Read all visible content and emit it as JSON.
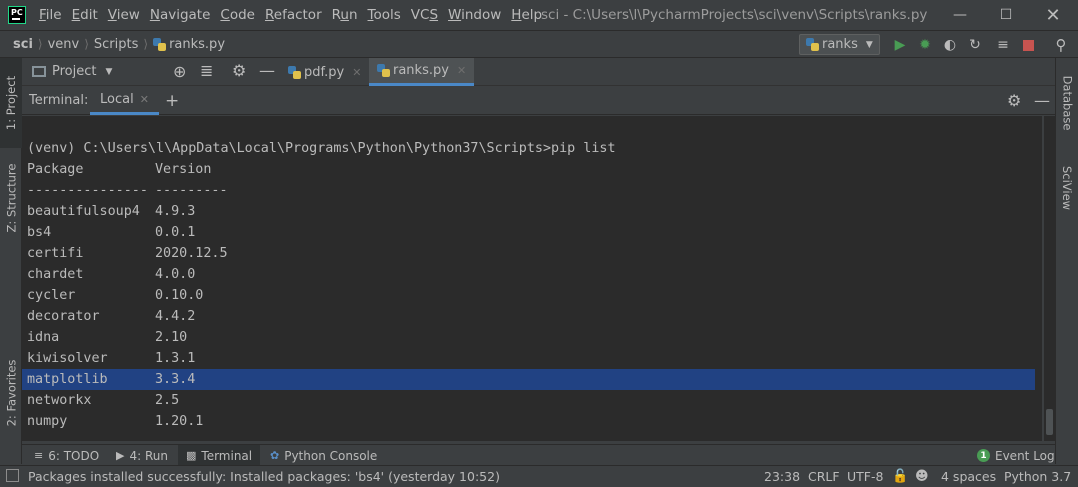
{
  "titlebar": {
    "logo_text": "PC",
    "menu": [
      {
        "pre": "",
        "u": "F",
        "post": "ile"
      },
      {
        "pre": "",
        "u": "E",
        "post": "dit"
      },
      {
        "pre": "",
        "u": "V",
        "post": "iew"
      },
      {
        "pre": "",
        "u": "N",
        "post": "avigate"
      },
      {
        "pre": "",
        "u": "C",
        "post": "ode"
      },
      {
        "pre": "",
        "u": "R",
        "post": "efactor"
      },
      {
        "pre": "R",
        "u": "u",
        "post": "n"
      },
      {
        "pre": "",
        "u": "T",
        "post": "ools"
      },
      {
        "pre": "VC",
        "u": "S",
        "post": ""
      },
      {
        "pre": "",
        "u": "W",
        "post": "indow"
      },
      {
        "pre": "",
        "u": "H",
        "post": "elp"
      }
    ],
    "window_title": "sci - C:\\Users\\l\\PycharmProjects\\sci\\venv\\Scripts\\ranks.py"
  },
  "navbar": {
    "crumbs": [
      "sci",
      "venv",
      "Scripts",
      "ranks.py"
    ],
    "run_config": "ranks"
  },
  "left_strip": {
    "project": "1: Project",
    "structure": "Z: Structure",
    "favorites": "2: Favorites"
  },
  "right_strip": {
    "database": "Database",
    "sciview": "SciView"
  },
  "tabrow": {
    "project_label": "Project",
    "tabs": [
      "pdf.py",
      "ranks.py"
    ]
  },
  "terminal": {
    "title": "Terminal:",
    "tab": "Local",
    "prompt": "(venv) C:\\Users\\l\\AppData\\Local\\Programs\\Python\\Python37\\Scripts>pip list",
    "header": {
      "name": "Package",
      "version": "Version"
    },
    "divider": {
      "name": "---------------",
      "version": "---------"
    },
    "packages": [
      {
        "name": "beautifulsoup4",
        "version": "4.9.3"
      },
      {
        "name": "bs4",
        "version": "0.0.1"
      },
      {
        "name": "certifi",
        "version": "2020.12.5"
      },
      {
        "name": "chardet",
        "version": "4.0.0"
      },
      {
        "name": "cycler",
        "version": "0.10.0"
      },
      {
        "name": "decorator",
        "version": "4.4.2"
      },
      {
        "name": "idna",
        "version": "2.10"
      },
      {
        "name": "kiwisolver",
        "version": "1.3.1"
      },
      {
        "name": "matplotlib",
        "version": "3.3.4"
      },
      {
        "name": "networkx",
        "version": "2.5"
      },
      {
        "name": "numpy",
        "version": "1.20.1"
      }
    ],
    "selected_package": "matplotlib"
  },
  "bottom_tabs": {
    "todo": "6: TODO",
    "run": "4: Run",
    "terminal": "Terminal",
    "python_console": "Python Console",
    "event_log": "Event Log",
    "event_count": "1"
  },
  "statusbar": {
    "message": "Packages installed successfully: Installed packages: 'bs4' (yesterday 10:52)",
    "position": "23:38",
    "line_sep": "CRLF",
    "encoding": "UTF-8",
    "indent": "4 spaces",
    "interpreter": "Python 3.7"
  },
  "colors": {
    "background": "#3c3f41",
    "terminal_bg": "#2b2b2b",
    "selection": "#214283",
    "accent": "#4a88c7",
    "run_green": "#499c54",
    "stop_red": "#c75450"
  }
}
